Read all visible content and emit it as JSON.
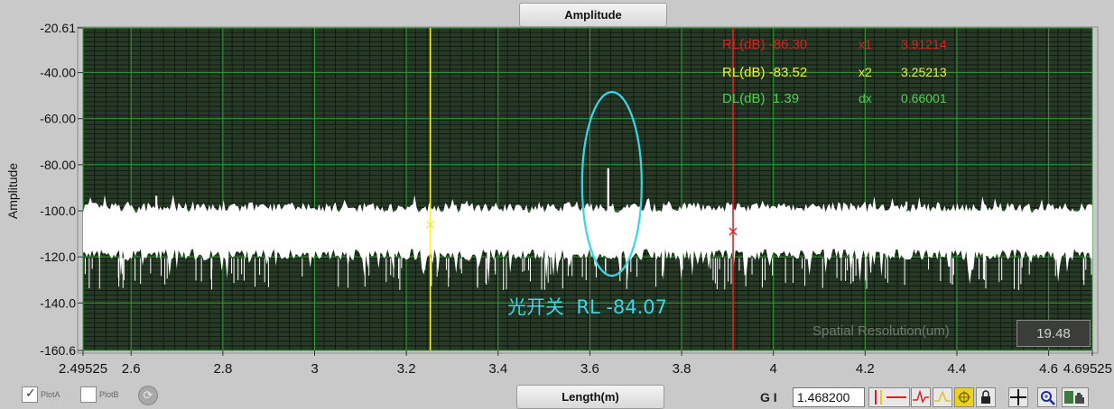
{
  "plot": {
    "title": "Amplitude",
    "x_axis_label": "Length(m)",
    "y_axis_label": "Amplitude"
  },
  "cursors": {
    "rows": [
      {
        "name": "RL(dB)",
        "value": "-86.30",
        "xname": "x1",
        "xvalue": "3.91214",
        "color": "#e41e1e"
      },
      {
        "name": "RL(dB)",
        "value": "-83.52",
        "xname": "x2",
        "xvalue": "3.25213",
        "color": "#f2ee3a"
      },
      {
        "name": "DL(dB)",
        "value": "1.39",
        "xname": "dx",
        "xvalue": "0.66001",
        "color": "#4fd24f"
      }
    ]
  },
  "annotation": {
    "text": "光开关  RL -84.07",
    "color": "#39d6e8"
  },
  "spatial_resolution": {
    "label": "Spatial Resolution(um)",
    "value": "19.48"
  },
  "legend": {
    "plot_a": "PlotA",
    "plot_b": "PlotB",
    "plot_a_checked": true,
    "plot_b_checked": false
  },
  "gi": {
    "label": "G I",
    "value": "1.468200"
  },
  "toolbar_icons": [
    "cursor-lines-icon",
    "red-trace-icon",
    "yellow-trace-icon",
    "highlight-icon",
    "lock-icon",
    "crosshair-icon",
    "zoom-icon",
    "pan-hand-icon"
  ],
  "chart_data": {
    "type": "line",
    "title": "Amplitude",
    "xlabel": "Length(m)",
    "ylabel": "Amplitude",
    "xlim": [
      2.49525,
      4.69525
    ],
    "ylim": [
      -160.6,
      -20.61
    ],
    "x_ticks": [
      "2.49525",
      "2.6",
      "2.8",
      "3",
      "3.2",
      "3.4",
      "3.6",
      "3.8",
      "4",
      "4.2",
      "4.4",
      "4.6",
      "4.69525"
    ],
    "x_tick_values": [
      2.49525,
      2.6,
      2.8,
      3.0,
      3.2,
      3.4,
      3.6,
      3.8,
      4.0,
      4.2,
      4.4,
      4.6,
      4.69525
    ],
    "y_ticks": [
      "-20.61",
      "-40.00",
      "-60.00",
      "-80.00",
      "-100.0",
      "-120.0",
      "-140.0",
      "-160.6"
    ],
    "y_tick_values": [
      -20.61,
      -40,
      -60,
      -80,
      -100,
      -120,
      -140,
      -160.6
    ],
    "grid": true,
    "background": "#273a27",
    "series": [
      {
        "color": "#ffffff",
        "noise_floor_upper_db": -99.5,
        "noise_floor_lower_db": -116.5,
        "spikes": [
          {
            "x": 2.655,
            "y": -93.5
          },
          {
            "x": 3.64,
            "y": -81.5
          },
          {
            "x": 4.29,
            "y": -96.0
          }
        ]
      }
    ],
    "cursors": [
      {
        "name": "x1",
        "x": 3.91214,
        "y": -109.0,
        "color": "#e41e1e"
      },
      {
        "name": "x2",
        "x": 3.25213,
        "y": -106.0,
        "color": "#f2ee3a"
      }
    ],
    "highlight": {
      "x": 3.648,
      "y": -88.3,
      "color": "#39d6e8"
    }
  }
}
